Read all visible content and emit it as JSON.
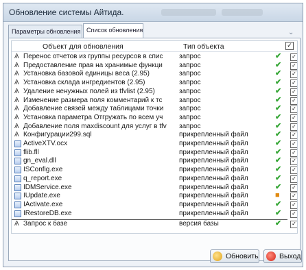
{
  "window": {
    "title": "Обновление системы Айтида."
  },
  "tabs": [
    {
      "label": "Параметры обновления",
      "active": false
    },
    {
      "label": "Список обновления",
      "active": true
    }
  ],
  "table": {
    "columns": [
      "Объект для обновления",
      "Тип объекта"
    ],
    "header_checkbox": "✓",
    "rows": [
      {
        "icon": "query-icon",
        "name": "Перенос отчетов из группы ресурсов в спис",
        "type": "запрос",
        "status": "ok",
        "checked": true
      },
      {
        "icon": "query-icon",
        "name": "Предоставление прав на хранимые функци",
        "type": "запрос",
        "status": "ok",
        "checked": true
      },
      {
        "icon": "query-icon",
        "name": "Установка базовой единицы веса (2.95)",
        "type": "запрос",
        "status": "ok",
        "checked": true
      },
      {
        "icon": "query-icon",
        "name": "Установка склада ингредиентов (2.95)",
        "type": "запрос",
        "status": "ok",
        "checked": true
      },
      {
        "icon": "query-icon",
        "name": "Удаление ненужных полей из tfvlist (2.95)",
        "type": "запрос",
        "status": "ok",
        "checked": true
      },
      {
        "icon": "query-icon",
        "name": "Изменение размера поля комментарий к тс",
        "type": "запрос",
        "status": "ok",
        "checked": true
      },
      {
        "icon": "query-icon",
        "name": "Добавление связей между таблицами точки",
        "type": "запрос",
        "status": "ok",
        "checked": true
      },
      {
        "icon": "query-icon",
        "name": "Установка параметра Отгружать по всем уч",
        "type": "запрос",
        "status": "ok",
        "checked": true
      },
      {
        "icon": "query-icon",
        "name": "Добавление поля maxdiscount для услуг в tfv",
        "type": "запрос",
        "status": "ok",
        "checked": true
      },
      {
        "icon": "query-icon",
        "name": "Конфигурации299.sql",
        "type": "прикрепленный файл",
        "status": "ok",
        "checked": true
      },
      {
        "icon": "file-icon",
        "name": "ActiveXTV.ocx",
        "type": "прикрепленный файл",
        "status": "ok",
        "checked": true
      },
      {
        "icon": "file-icon",
        "name": "flib.fll",
        "type": "прикрепленный файл",
        "status": "ok",
        "checked": true
      },
      {
        "icon": "file-icon",
        "name": "gn_eval.dll",
        "type": "прикрепленный файл",
        "status": "ok",
        "checked": true
      },
      {
        "icon": "file-icon",
        "name": "ISConfig.exe",
        "type": "прикрепленный файл",
        "status": "ok",
        "checked": true
      },
      {
        "icon": "file-icon",
        "name": "q_report.exe",
        "type": "прикрепленный файл",
        "status": "ok",
        "checked": true
      },
      {
        "icon": "file-icon",
        "name": "IDMService.exe",
        "type": "прикрепленный файл",
        "status": "ok",
        "checked": true
      },
      {
        "icon": "file-icon",
        "name": "IUpdate.exe",
        "type": "прикрепленный файл",
        "status": "warn",
        "checked": true
      },
      {
        "icon": "file-icon",
        "name": "IActivate.exe",
        "type": "прикрепленный файл",
        "status": "ok",
        "checked": true
      },
      {
        "icon": "file-icon",
        "name": "IRestoreDB.exe",
        "type": "прикрепленный файл",
        "status": "ok",
        "checked": true
      },
      {
        "icon": "query-icon",
        "name": "Запрос к базе",
        "type": "версия базы",
        "status": "ok",
        "checked": true
      }
    ]
  },
  "buttons": {
    "refresh": "Обновить",
    "exit": "Выход"
  },
  "colors": {
    "ok": "#2fa32f",
    "warn": "#e08a12"
  }
}
